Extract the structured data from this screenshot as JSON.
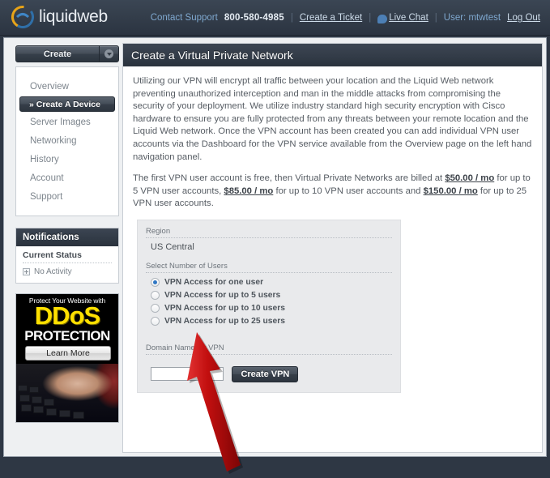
{
  "header": {
    "logo_text": "liquidweb",
    "logo_icon": "liquidweb-swirl-logo",
    "contact_label": "Contact Support",
    "phone": "800-580-4985",
    "create_ticket": "Create a Ticket",
    "live_chat": "Live Chat",
    "live_chat_icon": "chat-bubble-icon",
    "user_label": "User: mtwtest",
    "log_out": "Log Out",
    "separator": "|"
  },
  "sidebar": {
    "create_button": "Create",
    "create_caret_icon": "chevron-down-icon",
    "nav": [
      {
        "label": "Overview",
        "selected": false
      },
      {
        "label": "» Create A Device",
        "selected": true
      },
      {
        "label": "Server Images",
        "selected": false
      },
      {
        "label": "Networking",
        "selected": false
      },
      {
        "label": "History",
        "selected": false
      },
      {
        "label": "Account",
        "selected": false
      },
      {
        "label": "Support",
        "selected": false
      }
    ],
    "notifications": {
      "title": "Notifications",
      "status_label": "Current Status",
      "activity_icon": "expand-plus-icon",
      "activity_text": "No Activity"
    },
    "ad": {
      "tagline": "Protect Your Website with",
      "headline": "DDoS",
      "subhead": "PROTECTION",
      "cta": "Learn More",
      "headline_color": "#ffe000"
    }
  },
  "main": {
    "title": "Create a Virtual Private Network",
    "paragraph_1": "Utilizing our VPN will encrypt all traffic between your location and the Liquid Web network preventing unauthorized interception and man in the middle attacks from compromising the security of your deployment. We utilize industry standard high security encryption with Cisco hardware to ensure you are fully protected from any threats between your remote location and the Liquid Web network. Once the VPN account has been created you can add individual VPN user accounts via the Dashboard for the VPN service available from the Overview page on the left hand navigation panel.",
    "pricing": {
      "lead": "The first VPN user account is free, then Virtual Private Networks are billed at ",
      "price_1": "$50.00 / mo",
      "mid_1": " for up to 5 VPN user accounts, ",
      "price_2": "$85.00 / mo",
      "mid_2": " for up to 10 VPN user accounts and ",
      "price_3": "$150.00 / mo",
      "tail": " for up to 25 VPN user accounts."
    },
    "form": {
      "region_label": "Region",
      "region_value": "US Central",
      "users_label": "Select Number of Users",
      "user_options": [
        {
          "label": "VPN Access for one user",
          "selected": true
        },
        {
          "label": "VPN Access for up to 5 users",
          "selected": false
        },
        {
          "label": "VPN Access for up to 10 users",
          "selected": false
        },
        {
          "label": "VPN Access for up to 25 users",
          "selected": false
        }
      ],
      "domain_label": "Domain Name for VPN",
      "domain_value": "",
      "domain_placeholder": "",
      "submit_label": "Create VPN"
    }
  },
  "annotation": {
    "arrow_name": "red-pointer-arrow",
    "arrow_color": "#c00d0d",
    "points_to": "domain-name-input"
  }
}
